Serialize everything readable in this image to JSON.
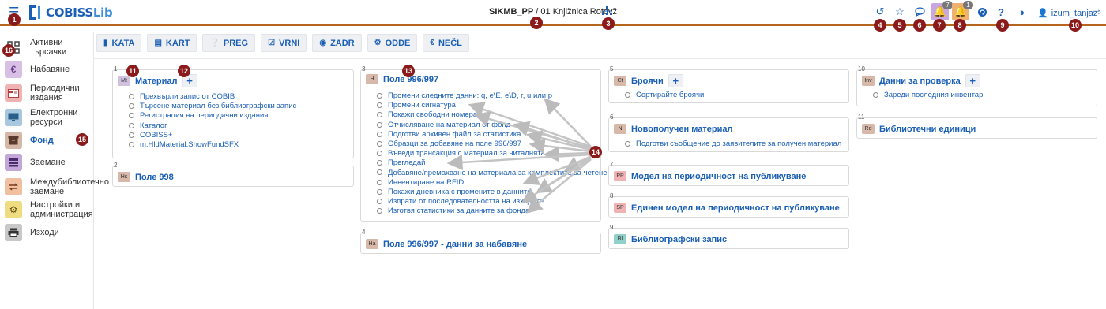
{
  "app": {
    "logo_main": "COBISS",
    "logo_sub": "Lib"
  },
  "header": {
    "library_code": "SIKMB_PP",
    "separator": " / ",
    "library_name": "01 Knjižnica Rotovž",
    "user_name": "izum_tanjaz"
  },
  "notifications": {
    "messages_count": "7",
    "alerts_count": "1"
  },
  "markers": [
    "1",
    "2",
    "3",
    "4",
    "5",
    "6",
    "7",
    "8",
    "9",
    "10",
    "11",
    "12",
    "13",
    "14",
    "15",
    "16"
  ],
  "sidebar": {
    "items": [
      {
        "label": "Активни търсачки",
        "icon": "grid-icon"
      },
      {
        "label": "Набавяне",
        "icon": "euro-icon"
      },
      {
        "label": "Периодични издания",
        "icon": "newspaper-icon"
      },
      {
        "label": "Електронни ресурси",
        "icon": "monitor-icon"
      },
      {
        "label": "Фонд",
        "icon": "archive-box-icon"
      },
      {
        "label": "Заемане",
        "icon": "books-icon"
      },
      {
        "label": "Междубиблиотечно заемане",
        "icon": "exchange-icon"
      },
      {
        "label": "Настройки и администрация",
        "icon": "gears-icon"
      },
      {
        "label": "Изходи",
        "icon": "printer-icon"
      }
    ]
  },
  "toolbar": {
    "buttons": [
      {
        "label": "KATA",
        "icon": "tag-icon"
      },
      {
        "label": "KART",
        "icon": "card-icon"
      },
      {
        "label": "PREG",
        "icon": "question-circle-icon"
      },
      {
        "label": "VRNI",
        "icon": "check-square-icon"
      },
      {
        "label": "ZADR",
        "icon": "lock-circle-icon"
      },
      {
        "label": "ODDE",
        "icon": "sitemap-icon"
      },
      {
        "label": "NEČL",
        "icon": "euro-icon"
      }
    ]
  },
  "cards": {
    "c1": {
      "num": "1",
      "badge": "Mt",
      "title": "Материал",
      "items": [
        "Прехвърли запис от COBIB",
        "Търсене материал без библиографски запис",
        "Регистрация на периодични издания",
        "Каталог",
        "COBISS+",
        "m.HldMaterial.ShowFundSFX"
      ]
    },
    "c2": {
      "num": "2",
      "badge": "Hs",
      "title": "Поле 998"
    },
    "c3": {
      "num": "3",
      "badge": "H",
      "title": "Поле 996/997",
      "items": [
        "Промени следните данни: q, e\\E, e\\D, r, u или p",
        "Промени сигнатура",
        "Покажи свободни номера",
        "Отчисляване на материал от фонд",
        "Подготви архивен файл за статистика",
        "Образци за добавяне на поле 996/997",
        "Въведи трансакция с материал за читалнята",
        "Прегледай",
        "Добавяне/премахване на материала за комплектите за четене",
        "Инвентиране на RFID",
        "Покажи дневника с промените в данните",
        "Изпрати от последователността на изходите",
        "Изготвя статистики за данните за фонда"
      ]
    },
    "c4": {
      "num": "4",
      "badge": "Ha",
      "title": "Поле 996/997 - данни за набавяне"
    },
    "c5": {
      "num": "5",
      "badge": "Ct",
      "title": "Броячи",
      "items": [
        "Сортирайте броячи"
      ]
    },
    "c6": {
      "num": "6",
      "badge": "N",
      "title": "Новополучен материал",
      "items": [
        "Подготви съобщение до заявителите за получен материал"
      ]
    },
    "c7": {
      "num": "7",
      "badge": "PP",
      "title": "Модел на периодичност на публикуване"
    },
    "c8": {
      "num": "8",
      "badge": "SP",
      "title": "Единен модел на периодичност на публикуване"
    },
    "c9": {
      "num": "9",
      "badge": "BI",
      "title": "Библиографски запис"
    },
    "c10": {
      "num": "10",
      "badge": "Inv",
      "title": "Данни за проверка",
      "items": [
        "Зареди последния инвентар"
      ]
    },
    "c11": {
      "num": "11",
      "badge": "Rd",
      "title": "Библиотечни единици"
    }
  },
  "colors": {
    "accent": "#1a5fb4",
    "header_border": "#b5651d",
    "marker": "#8b1a1a"
  }
}
